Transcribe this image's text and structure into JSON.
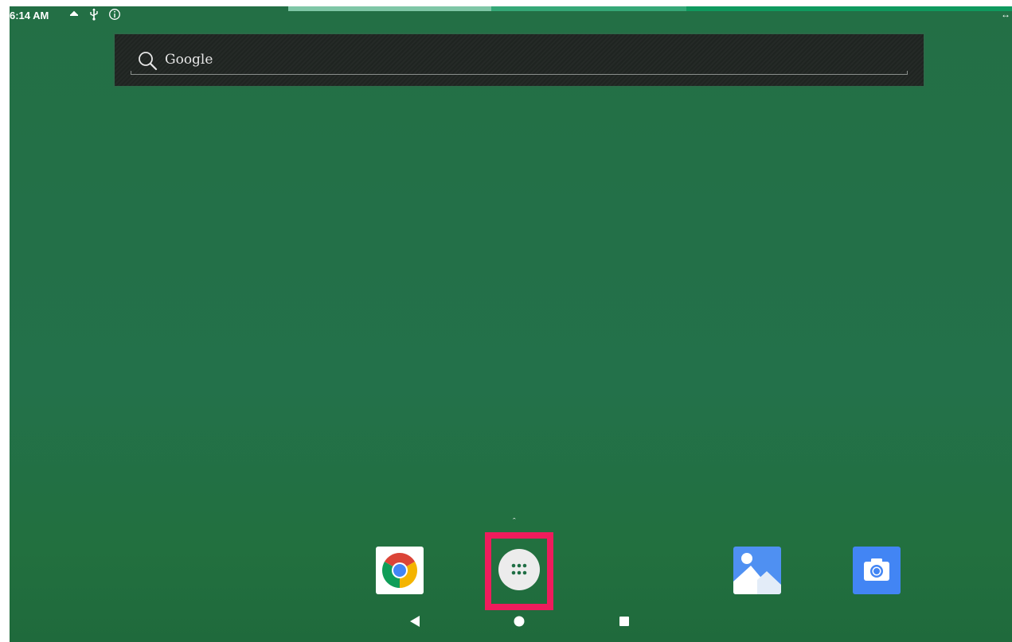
{
  "status_bar": {
    "time": "6:14 AM",
    "icons": [
      "home-icon",
      "usb-icon",
      "info-icon"
    ],
    "right_icon": "rotate-icon",
    "right_glyph": "↔"
  },
  "search_widget": {
    "label": "Google",
    "icon": "search-icon"
  },
  "swipe_hint": "ˆ",
  "dock": {
    "apps": [
      {
        "name": "chrome",
        "icon": "chrome-icon"
      },
      {
        "name": "all-apps",
        "icon": "apps-grid-icon",
        "highlighted": true,
        "highlight_color": "#ee1c5c"
      },
      {
        "name": "photos",
        "icon": "photos-icon"
      },
      {
        "name": "camera",
        "icon": "camera-icon"
      }
    ]
  },
  "nav_bar": {
    "buttons": [
      "back-icon",
      "home-circle-icon",
      "recents-icon"
    ]
  },
  "colors": {
    "wallpaper": "#236f45",
    "stripe_light": "#7fc6a6",
    "stripe_mid": "#35a877",
    "stripe_dark": "#0f9a5e",
    "highlight": "#ee1c5c"
  }
}
